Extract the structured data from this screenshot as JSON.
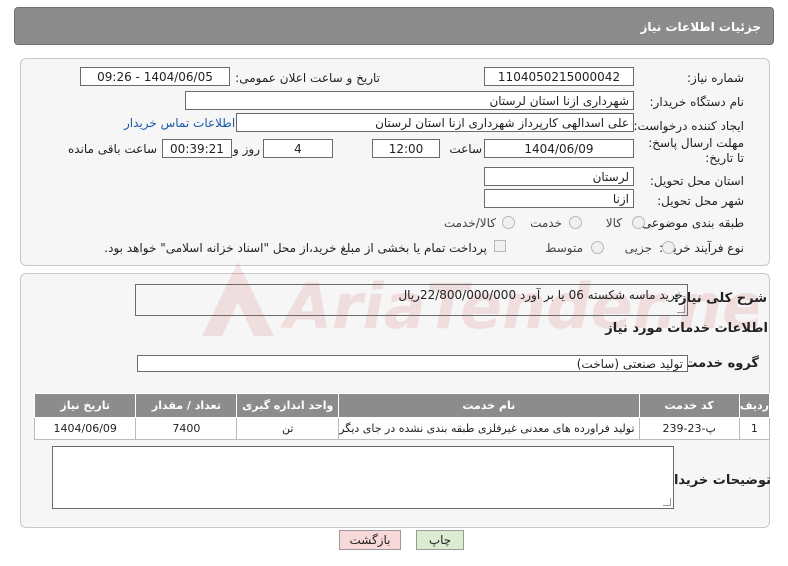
{
  "header": {
    "title": "جزئیات اطلاعات نیاز"
  },
  "form": {
    "need_number_label": "شماره نیاز:",
    "need_number": "1104050215000042",
    "announce_label": "تاریخ و ساعت اعلان عمومی:",
    "announce_value": "1404/06/05 - 09:26",
    "buyer_org_label": "نام دستگاه خریدار:",
    "buyer_org": "شهرداری ازنا استان لرستان",
    "creator_label": "ایجاد کننده درخواست:",
    "creator": "علی اسدالهی کارپرداز شهرداری ازنا استان لرستان",
    "contact_link": "اطلاعات تماس خریدار",
    "deadline_label": "مهلت ارسال پاسخ: تا تاریخ:",
    "deadline_date": "1404/06/09",
    "time_label": "ساعت",
    "deadline_time": "12:00",
    "days_value": "4",
    "days_label": "روز و",
    "remaining_time": "00:39:21",
    "remaining_label": "ساعت باقی مانده",
    "province_label": "استان محل تحویل:",
    "province": "لرستان",
    "city_label": "شهر محل تحویل:",
    "city": "ازنا",
    "category_label": "طبقه بندی موضوعی:",
    "category_options": [
      "کالا",
      "خدمت",
      "کالا/خدمت"
    ],
    "process_label": "نوع فرآیند خرید :",
    "process_options": [
      "جزیی",
      "متوسط"
    ],
    "treasury_note": "پرداخت تمام یا بخشی از مبلغ خرید،از محل \"اسناد خزانه اسلامی\" خواهد بود."
  },
  "details": {
    "summary_label": "شرح کلی نیاز:",
    "summary": "خرید ماسه شکسته 06 یا بر آورد 22/800/000/000ریال",
    "services_title": "اطلاعات خدمات مورد نیاز",
    "service_group_label": "گروه خدمت:",
    "service_group": "تولید صنعتی (ساخت)",
    "table": {
      "headers": [
        "ردیف",
        "کد خدمت",
        "نام خدمت",
        "واحد اندازه گیری",
        "تعداد / مقدار",
        "تاریخ نیاز"
      ],
      "rows": [
        [
          "1",
          "پ-23-239",
          "تولید فراورده های معدنی غیرفلزی طبقه بندی نشده در جای دیگر",
          "تن",
          "7400",
          "1404/06/09"
        ]
      ]
    },
    "buyer_notes_label": "توضیحات خریدار:",
    "buyer_notes": ""
  },
  "buttons": {
    "print": "چاپ",
    "back": "بازگشت"
  },
  "watermark": {
    "text": "AriaTender.neT"
  },
  "colors": {
    "header_bg": "#8c8c8c",
    "link": "#1a5aa6",
    "back_btn_bg": "#f7d9d9",
    "print_btn_bg": "#dcecd0",
    "watermark": "#c81c1c"
  }
}
